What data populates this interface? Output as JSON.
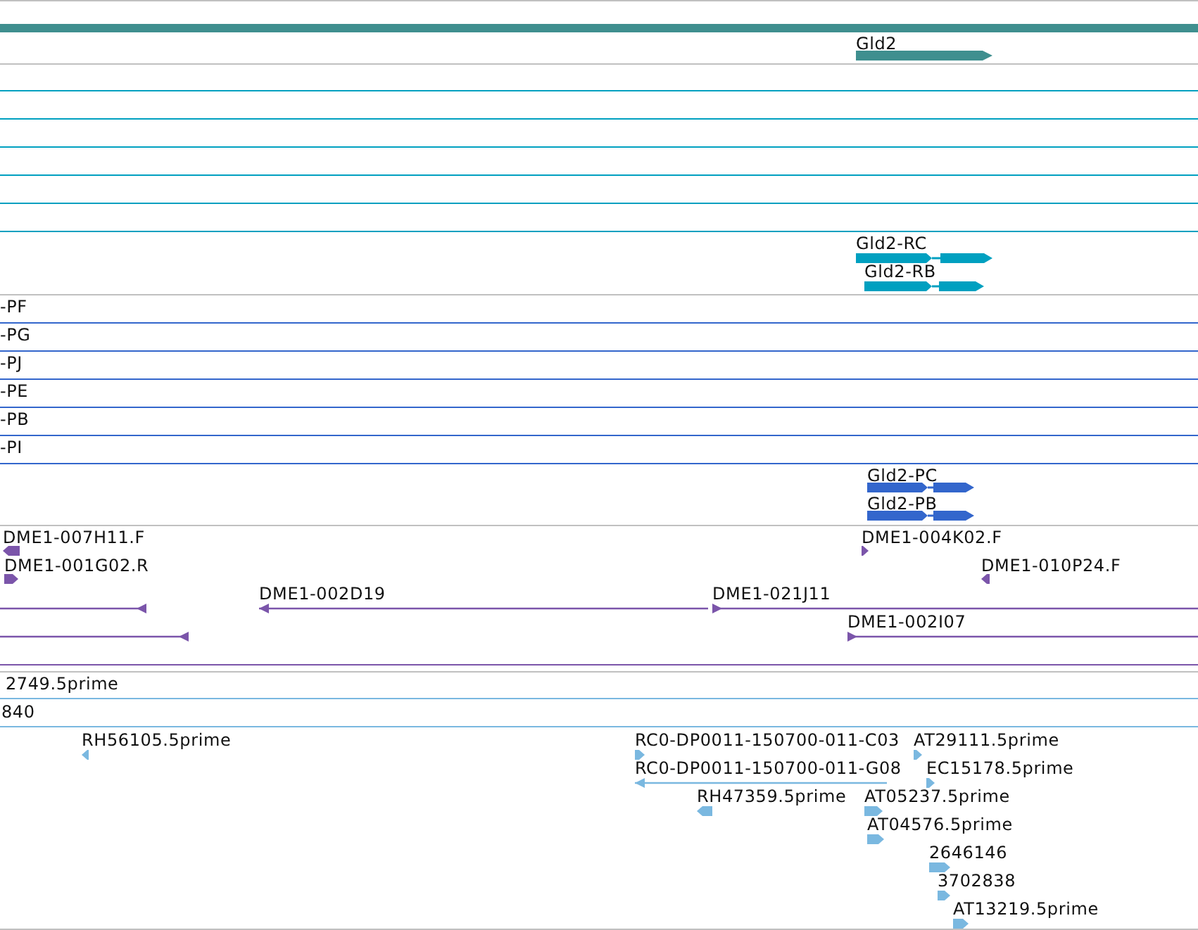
{
  "tracks": [
    {
      "color": "#3f8f8f",
      "features": [
        {
          "label": "Gld2",
          "kind": "bar",
          "forward": true
        }
      ]
    },
    {
      "color": "#00a0c0",
      "features": [
        {
          "label": "Gld2-RC",
          "kind": "spliced",
          "forward": true
        },
        {
          "label": "Gld2-RB",
          "kind": "spliced",
          "forward": true
        }
      ]
    },
    {
      "color": "#3366cc",
      "features": [
        {
          "label": "-PF",
          "kind": "clipped"
        },
        {
          "label": "-PG",
          "kind": "clipped"
        },
        {
          "label": "-PJ",
          "kind": "clipped"
        },
        {
          "label": "-PE",
          "kind": "clipped"
        },
        {
          "label": "-PB",
          "kind": "clipped"
        },
        {
          "label": "-PI",
          "kind": "clipped"
        },
        {
          "label": "Gld2-PC",
          "kind": "spliced",
          "forward": true
        },
        {
          "label": "Gld2-PB",
          "kind": "spliced",
          "forward": true
        }
      ]
    },
    {
      "color": "#7b55aa",
      "features": [
        {
          "label": "DME1-007H11.F",
          "kind": "mark",
          "forward": false
        },
        {
          "label": "DME1-004K02.F",
          "kind": "mark",
          "forward": true
        },
        {
          "label": "DME1-001G02.R",
          "kind": "mark",
          "forward": true
        },
        {
          "label": "DME1-010P24.F",
          "kind": "mark",
          "forward": false
        },
        {
          "kind": "line",
          "forward": false
        },
        {
          "label": "DME1-002D19",
          "kind": "line",
          "forward": false
        },
        {
          "label": "DME1-021J11",
          "kind": "line",
          "forward": true
        },
        {
          "kind": "line",
          "forward": false
        },
        {
          "label": "DME1-002I07",
          "kind": "line",
          "forward": true
        }
      ]
    },
    {
      "color": "#7ab8e0",
      "features": [
        {
          "label": "2749.5prime",
          "kind": "clipped"
        },
        {
          "label": "840",
          "kind": "clipped"
        },
        {
          "label": "RH56105.5prime",
          "kind": "mark",
          "forward": false
        },
        {
          "label": "RC0-DP0011-150700-011-C03",
          "kind": "mark",
          "forward": true
        },
        {
          "label": "AT29111.5prime",
          "kind": "mark",
          "forward": true
        },
        {
          "label": "RC0-DP0011-150700-011-G08",
          "kind": "line",
          "forward": false
        },
        {
          "label": "EC15178.5prime",
          "kind": "mark",
          "forward": true
        },
        {
          "label": "RH47359.5prime",
          "kind": "mark",
          "forward": false
        },
        {
          "label": "AT05237.5prime",
          "kind": "mark",
          "forward": true
        },
        {
          "label": "AT04576.5prime",
          "kind": "mark",
          "forward": true
        },
        {
          "label": "2646146",
          "kind": "mark",
          "forward": true
        },
        {
          "label": "3702838",
          "kind": "mark",
          "forward": true
        },
        {
          "label": "AT13219.5prime",
          "kind": "mark",
          "forward": true
        }
      ]
    }
  ]
}
